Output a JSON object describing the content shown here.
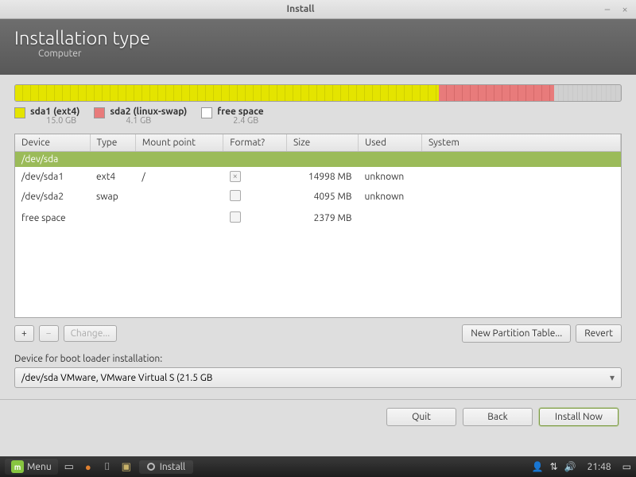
{
  "window": {
    "title": "Install"
  },
  "header": {
    "title": "Installation type",
    "subtitle": "Computer"
  },
  "usage": {
    "segments": [
      {
        "kind": "yellow",
        "percent": 70
      },
      {
        "kind": "pink",
        "percent": 19
      },
      {
        "kind": "free",
        "percent": 11
      }
    ]
  },
  "legend": [
    {
      "swatch": "yellow",
      "label": "sda1 (ext4)",
      "size": "15.0 GB"
    },
    {
      "swatch": "pink",
      "label": "sda2 (linux-swap)",
      "size": "4.1 GB"
    },
    {
      "swatch": "empty",
      "label": "free space",
      "size": "2.4 GB"
    }
  ],
  "columns": {
    "device": "Device",
    "type": "Type",
    "mount": "Mount point",
    "format": "Format?",
    "size": "Size",
    "used": "Used",
    "system": "System"
  },
  "disk_header": "/dev/sda",
  "rows": [
    {
      "device": "/dev/sda1",
      "type": "ext4",
      "mount": "/",
      "format": true,
      "size": "14998 MB",
      "used": "unknown"
    },
    {
      "device": "/dev/sda2",
      "type": "swap",
      "mount": "",
      "format": false,
      "size": "4095 MB",
      "used": "unknown"
    },
    {
      "device": "free space",
      "type": "",
      "mount": "",
      "format": false,
      "size": "2379 MB",
      "used": ""
    }
  ],
  "toolbar": {
    "add": "+",
    "remove": "−",
    "change": "Change...",
    "new_table": "New Partition Table...",
    "revert": "Revert"
  },
  "boot": {
    "label": "Device for boot loader installation:",
    "value": "/dev/sda   VMware, VMware Virtual S (21.5 GB"
  },
  "footer": {
    "quit": "Quit",
    "back": "Back",
    "install": "Install Now"
  },
  "taskbar": {
    "menu": "Menu",
    "active_task": "Install",
    "clock": "21:48"
  }
}
